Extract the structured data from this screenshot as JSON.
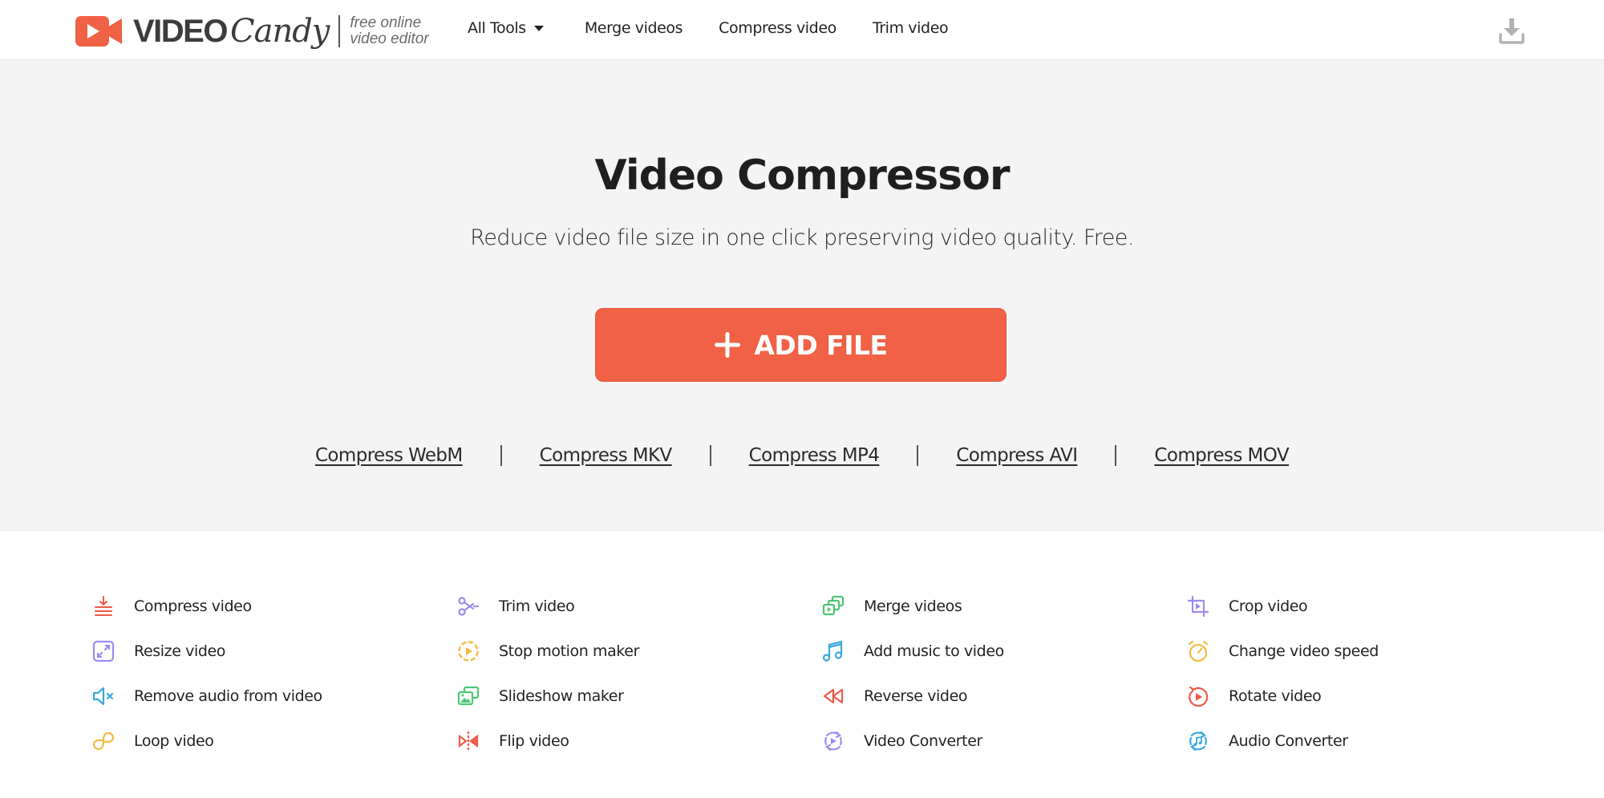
{
  "header": {
    "logo": {
      "word1": "VIDEO",
      "word2": "Candy",
      "tagline_line1": "free online",
      "tagline_line2": "video editor",
      "icon": "video-camera-icon"
    },
    "nav": [
      {
        "label": "All Tools",
        "has_dropdown": true
      },
      {
        "label": "Merge videos"
      },
      {
        "label": "Compress video"
      },
      {
        "label": "Trim video"
      }
    ],
    "download_icon": "download-icon"
  },
  "hero": {
    "title": "Video Compressor",
    "subtitle": "Reduce video file size in one click preserving video quality. Free.",
    "add_file_label": "ADD FILE",
    "add_file_icon": "plus-icon",
    "format_links": [
      "Compress WebM",
      "Compress MKV",
      "Compress MP4",
      "Compress AVI",
      "Compress MOV"
    ]
  },
  "tools": [
    {
      "label": "Compress video",
      "icon": "compress-icon",
      "color": "#ef5a4a"
    },
    {
      "label": "Trim video",
      "icon": "scissors-icon",
      "color": "#9b8cf0"
    },
    {
      "label": "Merge videos",
      "icon": "merge-icon",
      "color": "#4ec774"
    },
    {
      "label": "Crop video",
      "icon": "crop-icon",
      "color": "#9b8cf0"
    },
    {
      "label": "Resize video",
      "icon": "resize-icon",
      "color": "#9b8cf0"
    },
    {
      "label": "Stop motion maker",
      "icon": "stop-motion-icon",
      "color": "#f5b942"
    },
    {
      "label": "Add music to video",
      "icon": "music-note-icon",
      "color": "#3aa8e0"
    },
    {
      "label": "Change video speed",
      "icon": "stopwatch-icon",
      "color": "#f5b942"
    },
    {
      "label": "Remove audio from video",
      "icon": "mute-icon",
      "color": "#3aa8e0"
    },
    {
      "label": "Slideshow maker",
      "icon": "slideshow-icon",
      "color": "#4ec774"
    },
    {
      "label": "Reverse video",
      "icon": "rewind-icon",
      "color": "#ef5a4a"
    },
    {
      "label": "Rotate video",
      "icon": "rotate-icon",
      "color": "#ef5a4a"
    },
    {
      "label": "Loop video",
      "icon": "loop-icon",
      "color": "#f5b942"
    },
    {
      "label": "Flip video",
      "icon": "flip-icon",
      "color": "#ef5a4a"
    },
    {
      "label": "Video Converter",
      "icon": "video-convert-icon",
      "color": "#9b8cf0"
    },
    {
      "label": "Audio Converter",
      "icon": "audio-convert-icon",
      "color": "#3aa8e0"
    }
  ],
  "colors": {
    "brand": "#f06145",
    "hero_bg": "#f4f4f4",
    "text": "#222222"
  }
}
